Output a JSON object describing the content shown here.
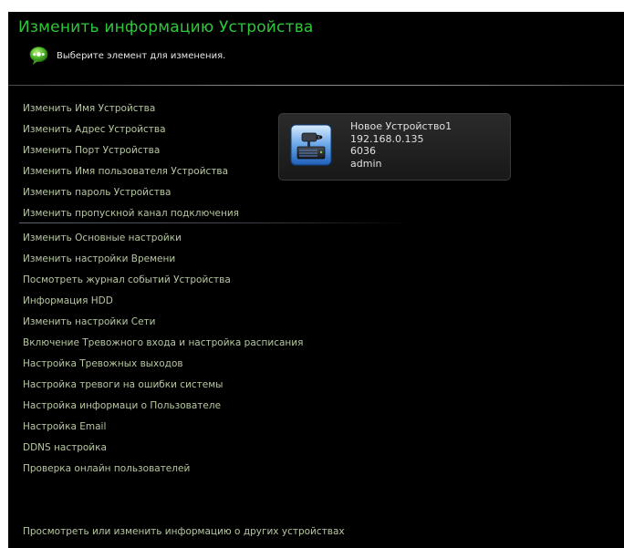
{
  "header": {
    "title": "Изменить информацию Устройства",
    "hint": "Выберите элемент для изменения."
  },
  "menu": [
    "Изменить Имя Устройства",
    "Изменить Адрес Устройства",
    "Изменить Порт Устройства",
    "Изменить Имя пользователя Устройства",
    "Изменить пароль Устройства",
    "Изменить пропускной канал подключения",
    "Изменить Основные настройки",
    "Изменить настройки Времени",
    "Посмотреть журнал событий Устройства",
    "Информация HDD",
    "Изменить настройки Сети",
    "Включение Тревожного входа и настройка расписания",
    "Настройка Тревожных выходов",
    "Настройка тревоги на ошибки системы",
    "Настройка информаци о Пользователе",
    "Настройка Email",
    "DDNS настройка",
    "Проверка онлайн пользователей"
  ],
  "footer_link": "Просмотреть или изменить информацию о других устройствах",
  "device": {
    "name": "Новое Устройство1",
    "address": "192.168.0.135",
    "port": "6036",
    "user": "admin"
  },
  "colors": {
    "title": "#2fc63a",
    "menu_text": "#b6c7a0",
    "background": "#000000"
  }
}
